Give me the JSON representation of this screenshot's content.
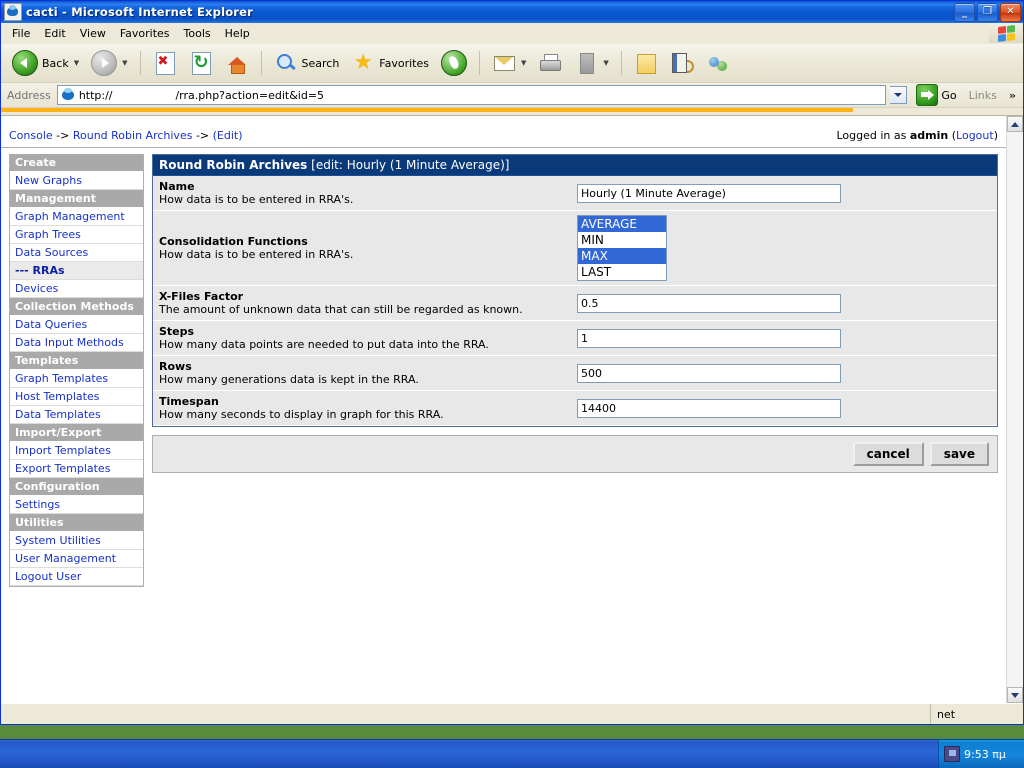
{
  "window": {
    "title": "cacti - Microsoft Internet Explorer",
    "minimize_label": "_",
    "restore_label": "❐",
    "close_label": "✕"
  },
  "menubar": {
    "items": [
      "File",
      "Edit",
      "View",
      "Favorites",
      "Tools",
      "Help"
    ]
  },
  "toolbar": {
    "back_label": "Back",
    "search_label": "Search",
    "favorites_label": "Favorites"
  },
  "address": {
    "label": "Address",
    "url": "http://                  /rra.php?action=edit&id=5",
    "go_label": "Go",
    "links_label": "Links",
    "chevron_label": "»"
  },
  "page": {
    "breadcrumb": {
      "console": "Console",
      "sep1": "->",
      "section": "Round Robin Archives",
      "sep2": "->",
      "current": "(Edit)"
    },
    "login_prefix": "Logged in as",
    "login_user": "admin",
    "login_paren_open": "(",
    "logout_label": "Logout",
    "login_paren_close": ")"
  },
  "sidebar": {
    "sections": [
      {
        "header": "Create",
        "items": [
          {
            "label": "New Graphs",
            "active": false
          }
        ]
      },
      {
        "header": "Management",
        "items": [
          {
            "label": "Graph Management",
            "active": false
          },
          {
            "label": "Graph Trees",
            "active": false
          },
          {
            "label": "Data Sources",
            "active": false
          },
          {
            "label": "--- RRAs",
            "active": true
          },
          {
            "label": "Devices",
            "active": false
          }
        ]
      },
      {
        "header": "Collection Methods",
        "items": [
          {
            "label": "Data Queries",
            "active": false
          },
          {
            "label": "Data Input Methods",
            "active": false
          }
        ]
      },
      {
        "header": "Templates",
        "items": [
          {
            "label": "Graph Templates",
            "active": false
          },
          {
            "label": "Host Templates",
            "active": false
          },
          {
            "label": "Data Templates",
            "active": false
          }
        ]
      },
      {
        "header": "Import/Export",
        "items": [
          {
            "label": "Import Templates",
            "active": false
          },
          {
            "label": "Export Templates",
            "active": false
          }
        ]
      },
      {
        "header": "Configuration",
        "items": [
          {
            "label": "Settings",
            "active": false
          }
        ]
      },
      {
        "header": "Utilities",
        "items": [
          {
            "label": "System Utilities",
            "active": false
          },
          {
            "label": "User Management",
            "active": false
          },
          {
            "label": "Logout User",
            "active": false
          }
        ]
      }
    ]
  },
  "form": {
    "panel_title": "Round Robin Archives",
    "panel_subtitle": "[edit: Hourly (1 Minute Average)]",
    "fields": [
      {
        "name": "Name",
        "description": "How data is to be entered in RRA's.",
        "type": "text",
        "value": "Hourly (1 Minute Average)"
      },
      {
        "name": "Consolidation Functions",
        "description": "How data is to be entered in RRA's.",
        "type": "listbox",
        "options": [
          {
            "label": "AVERAGE",
            "selected": true
          },
          {
            "label": "MIN",
            "selected": false
          },
          {
            "label": "MAX",
            "selected": true
          },
          {
            "label": "LAST",
            "selected": false
          }
        ]
      },
      {
        "name": "X-Files Factor",
        "description": "The amount of unknown data that can still be regarded as known.",
        "type": "text",
        "value": "0.5"
      },
      {
        "name": "Steps",
        "description": "How many data points are needed to put data into the RRA.",
        "type": "text",
        "value": "1"
      },
      {
        "name": "Rows",
        "description": "How many generations data is kept in the RRA.",
        "type": "text",
        "value": "500"
      },
      {
        "name": "Timespan",
        "description": "How many seconds to display in graph for this RRA.",
        "type": "text",
        "value": "14400"
      }
    ],
    "cancel_label": "cancel",
    "save_label": "save"
  },
  "statusbar": {
    "message": "",
    "zone": "net"
  },
  "taskbar": {
    "clock": "9:53 πμ"
  },
  "colors": {
    "title_blue": "#0a58d0",
    "panel_header": "#0b3a7a",
    "link_blue": "#1831c8",
    "nav_header_gray": "#a9a9a9",
    "row_gray": "#e8e8e8",
    "select_highlight": "#3267d6",
    "links_orange": "#ffb11a"
  }
}
